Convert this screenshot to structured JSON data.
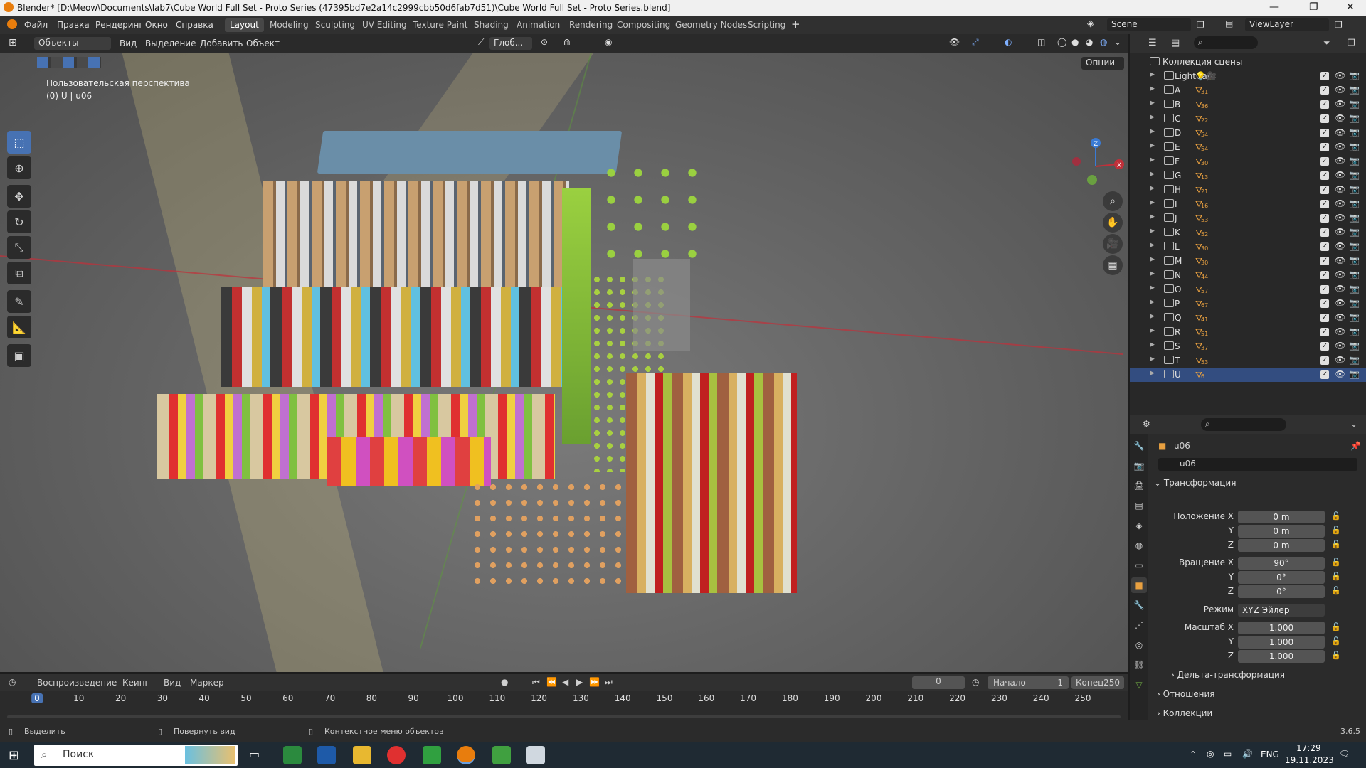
{
  "window": {
    "title": "Blender* [D:\\Meow\\Documents\\lab7\\Cube World Full Set - Proto Series (47395bd7e2a14c2999cbb50d6fab7d51)\\Cube World Full Set - Proto Series.blend]"
  },
  "menu": [
    "Файл",
    "Правка",
    "Рендеринг",
    "Окно",
    "Справка"
  ],
  "workspaces": [
    "Layout",
    "Modeling",
    "Sculpting",
    "UV Editing",
    "Texture Paint",
    "Shading",
    "Animation",
    "Rendering",
    "Compositing",
    "Geometry Nodes",
    "Scripting"
  ],
  "active_workspace": "Layout",
  "scene": {
    "label": "Scene",
    "view_layer": "ViewLayer"
  },
  "viewport": {
    "mode": "Объекты",
    "menus": [
      "Вид",
      "Выделение",
      "Добавить",
      "Объект"
    ],
    "orientation": "Глоб...",
    "options_label": "Опции",
    "overlay_title": "Пользовательская перспектива",
    "overlay_sub": "(0) U | u06"
  },
  "outliner": {
    "root": "Коллекция сцены",
    "collections": [
      {
        "name": "LightCam",
        "count": ""
      },
      {
        "name": "A",
        "count": "31"
      },
      {
        "name": "B",
        "count": "36"
      },
      {
        "name": "C",
        "count": "22"
      },
      {
        "name": "D",
        "count": "54"
      },
      {
        "name": "E",
        "count": "54"
      },
      {
        "name": "F",
        "count": "30"
      },
      {
        "name": "G",
        "count": "13"
      },
      {
        "name": "H",
        "count": "21"
      },
      {
        "name": "I",
        "count": "16"
      },
      {
        "name": "J",
        "count": "53"
      },
      {
        "name": "K",
        "count": "52"
      },
      {
        "name": "L",
        "count": "30"
      },
      {
        "name": "M",
        "count": "30"
      },
      {
        "name": "N",
        "count": "44"
      },
      {
        "name": "O",
        "count": "57"
      },
      {
        "name": "P",
        "count": "67"
      },
      {
        "name": "Q",
        "count": "41"
      },
      {
        "name": "R",
        "count": "51"
      },
      {
        "name": "S",
        "count": "37"
      },
      {
        "name": "T",
        "count": "53"
      },
      {
        "name": "U",
        "count": "6"
      }
    ],
    "selected": "U"
  },
  "properties": {
    "object_name": "u06",
    "object_field": "u06",
    "transform_header": "Трансформация",
    "location_label": "Положение X",
    "rotation_label": "Вращение X",
    "scale_label": "Масштаб X",
    "y_label": "Y",
    "z_label": "Z",
    "location": [
      "0 m",
      "0 m",
      "0 m"
    ],
    "rotation": [
      "90°",
      "0°",
      "0°"
    ],
    "mode_label": "Режим",
    "mode_value": "XYZ Эйлер",
    "scale": [
      "1.000",
      "1.000",
      "1.000"
    ],
    "delta": "Дельта-трансформация",
    "relations": "Отношения",
    "collections": "Коллекции",
    "version": "3.6.5"
  },
  "timeline": {
    "playback": "Воспроизведение",
    "keying": "Кеинг",
    "view": "Вид",
    "marker": "Маркер",
    "current_frame": "0",
    "start_label": "Начало",
    "start": "1",
    "end_label": "Конец",
    "end": "250",
    "ticks": [
      "0",
      "10",
      "20",
      "30",
      "40",
      "50",
      "60",
      "70",
      "80",
      "90",
      "100",
      "110",
      "120",
      "130",
      "140",
      "150",
      "160",
      "170",
      "180",
      "190",
      "200",
      "210",
      "220",
      "230",
      "240",
      "250"
    ]
  },
  "status": {
    "select": "Выделить",
    "rotate": "Повернуть вид",
    "context": "Контекстное меню объектов"
  },
  "taskbar": {
    "search": "Поиск",
    "lang": "ENG",
    "time": "17:29",
    "date": "19.11.2023"
  },
  "colors": {
    "accent": "#4772b3",
    "selected_row": "#334d80",
    "x_axis": "#c0303a",
    "y_axis": "#6aa040",
    "z_axis": "#3a7bd5"
  }
}
